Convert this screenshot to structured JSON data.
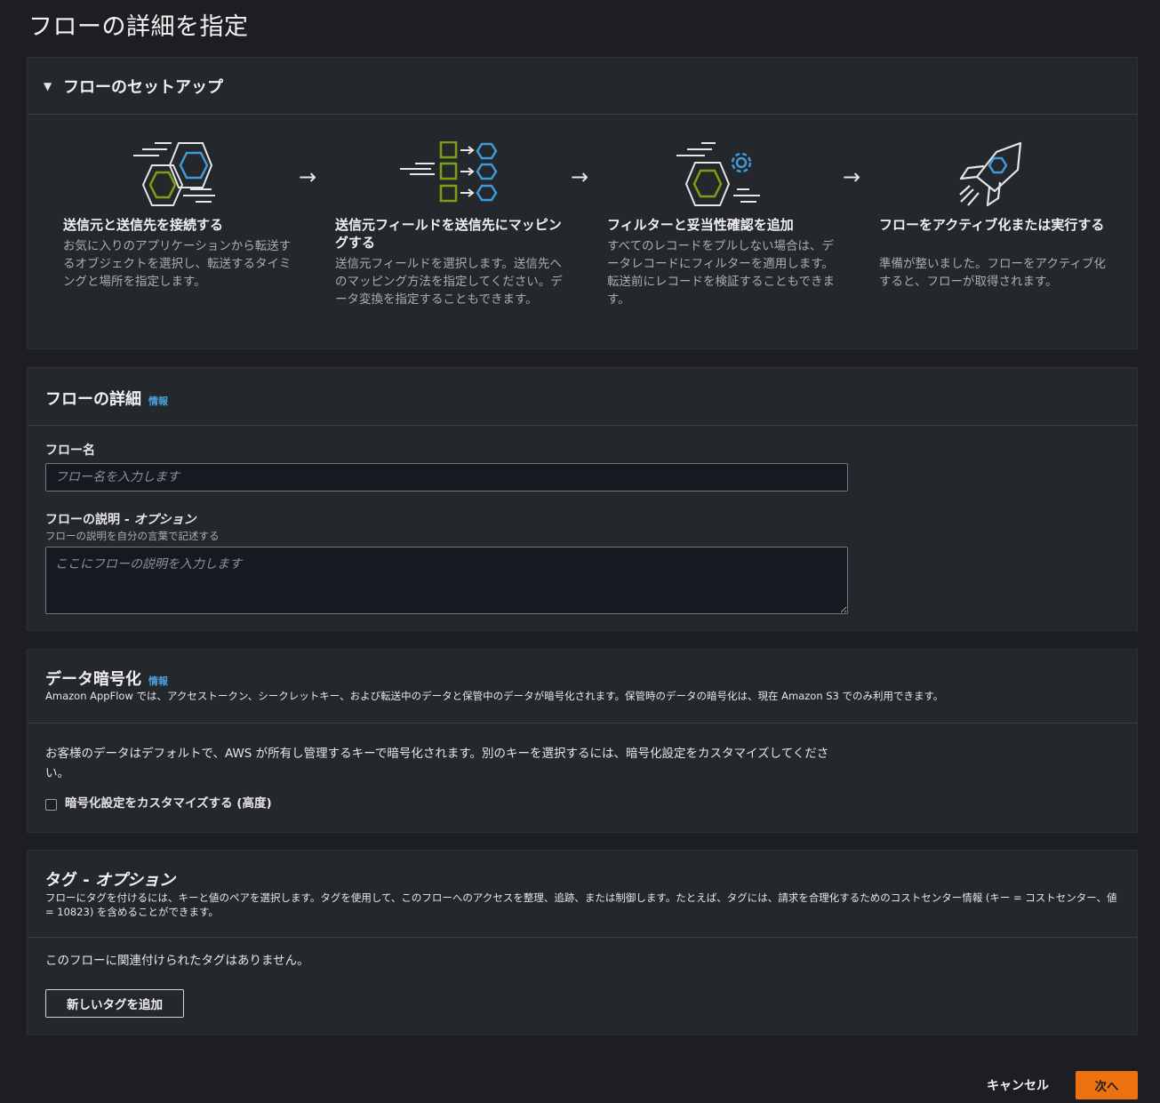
{
  "page": {
    "title": "フローの詳細を指定"
  },
  "setup": {
    "title": "フローのセットアップ",
    "arrow": "→",
    "steps": [
      {
        "icon": "connect-hexagons-icon",
        "title": "送信元と送信先を接続する",
        "desc": "お気に入りのアプリケーションから転送するオブジェクトを選択し、転送するタイミングと場所を指定します。"
      },
      {
        "icon": "field-mapping-icon",
        "title": "送信元フィールドを送信先にマッピングする",
        "desc": "送信元フィールドを選択します。送信先へのマッピング方法を指定してください。データ変換を指定することもできます。"
      },
      {
        "icon": "filter-gear-icon",
        "title": "フィルターと妥当性確認を追加",
        "desc": "すべてのレコードをプルしない場合は、データレコードにフィルターを適用します。転送前にレコードを検証することもできます。"
      },
      {
        "icon": "rocket-icon",
        "title": "フローをアクティブ化または実行する",
        "desc": "準備が整いました。フローをアクティブ化すると、フローが取得されます。"
      }
    ]
  },
  "details": {
    "title": "フローの詳細",
    "info": "情報",
    "name_label": "フロー名",
    "name_placeholder": "フロー名を入力します",
    "desc_label_main": "フローの説明 - ",
    "desc_label_opt": "オプション",
    "desc_sub": "フローの説明を自分の言葉で記述する",
    "desc_placeholder": "ここにフローの説明を入力します"
  },
  "encryption": {
    "title": "データ暗号化",
    "info": "情報",
    "desc": "Amazon AppFlow では、アクセストークン、シークレットキー、および転送中のデータと保管中のデータが暗号化されます。保管時のデータの暗号化は、現在 Amazon S3 でのみ利用できます。",
    "body": "お客様のデータはデフォルトで、AWS が所有し管理するキーで暗号化されます。別のキーを選択するには、暗号化設定をカスタマイズしてください。",
    "checkbox_label": "暗号化設定をカスタマイズする (高度)",
    "checkbox_checked": false
  },
  "tags": {
    "title_main": "タグ - ",
    "title_opt": "オプション",
    "desc": "フローにタグを付けるには、キーと値のペアを選択します。タグを使用して、このフローへのアクセスを整理、追跡、または制御します。たとえば、タグには、請求を合理化するためのコストセンター情報 (キー = コストセンター、値 = 10823) を含めることができます。",
    "empty": "このフローに関連付けられたタグはありません。",
    "add_button": "新しいタグを追加"
  },
  "footer": {
    "cancel": "キャンセル",
    "next": "次へ"
  },
  "colors": {
    "accent": "#ec7211",
    "link": "#4aa3df",
    "icon_green": "#7aa116",
    "icon_blue": "#3f9ad6"
  }
}
